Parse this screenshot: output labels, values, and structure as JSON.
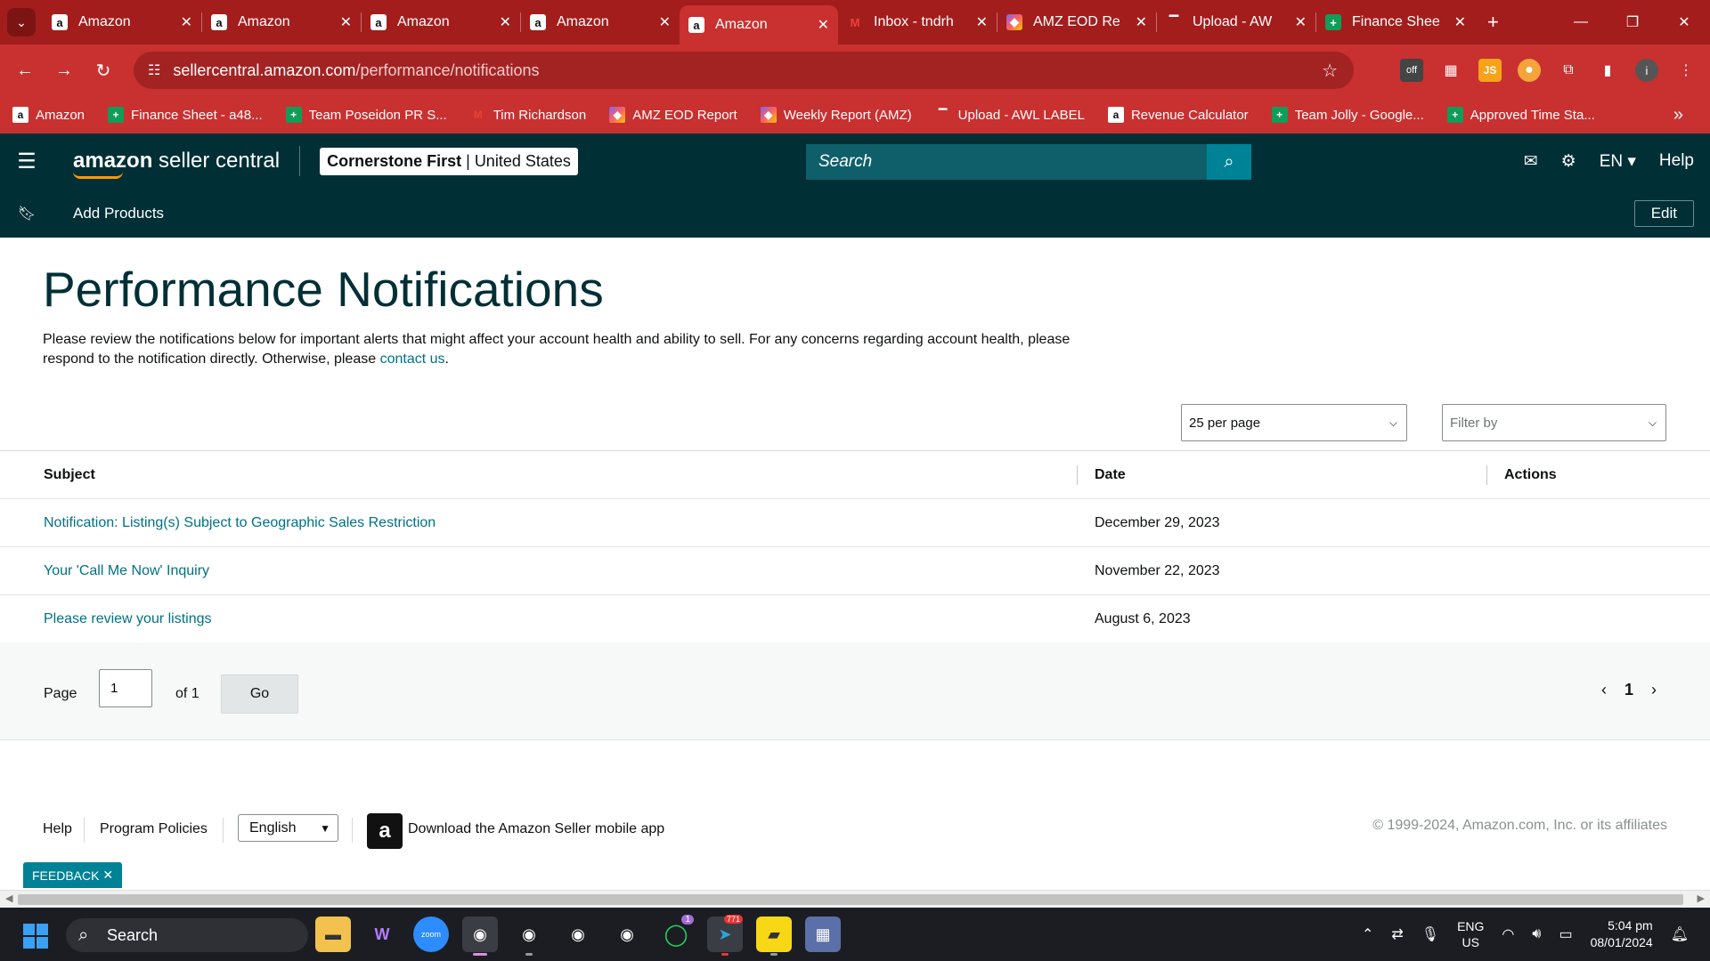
{
  "browser": {
    "tabs": [
      {
        "title": "Amazon",
        "icon": "amazon-icon",
        "active": false
      },
      {
        "title": "Amazon",
        "icon": "amazon-icon",
        "active": false
      },
      {
        "title": "Amazon",
        "icon": "amazon-icon",
        "active": false
      },
      {
        "title": "Amazon",
        "icon": "amazon-icon",
        "active": false
      },
      {
        "title": "Amazon",
        "icon": "amazon-icon",
        "active": true
      },
      {
        "title": "Inbox - tndrh",
        "icon": "gmail-icon",
        "active": false
      },
      {
        "title": "AMZ EOD Re",
        "icon": "clickup-icon",
        "active": false
      },
      {
        "title": "Upload - AW",
        "icon": "upload-icon",
        "active": false
      },
      {
        "title": "Finance Shee",
        "icon": "sheets-icon",
        "active": false
      }
    ],
    "url_host": "sellercentral.amazon.com",
    "url_path": "/performance/notifications",
    "bookmarks": [
      {
        "title": "Amazon",
        "icon": "amazon-icon"
      },
      {
        "title": "Finance Sheet - a48...",
        "icon": "sheets-icon"
      },
      {
        "title": "Team Poseidon PR S...",
        "icon": "sheets-icon"
      },
      {
        "title": "Tim Richardson",
        "icon": "gmail-icon"
      },
      {
        "title": "AMZ EOD Report",
        "icon": "clickup-icon"
      },
      {
        "title": "Weekly Report (AMZ)",
        "icon": "clickup-icon"
      },
      {
        "title": "Upload - AWL LABEL",
        "icon": "upload-icon"
      },
      {
        "title": "Revenue Calculator",
        "icon": "amazon-icon"
      },
      {
        "title": "Team Jolly - Google...",
        "icon": "sheets-icon"
      },
      {
        "title": "Approved Time Sta...",
        "icon": "sheets-icon"
      }
    ]
  },
  "header": {
    "logo_bold": "amazon",
    "logo_rest": " seller central",
    "store_name": "Cornerstone First",
    "store_region": "United States",
    "search_placeholder": "Search",
    "language": "EN",
    "help": "Help"
  },
  "subnav": {
    "add_products": "Add Products",
    "edit": "Edit"
  },
  "page": {
    "title": "Performance Notifications",
    "intro": "Please review the notifications below for important alerts that might affect your account health and ability to sell. For any concerns regarding account health, please respond to the notification directly. Otherwise, please ",
    "contact_link": "contact us",
    "intro_end": ".",
    "per_page": "25 per page",
    "filter_placeholder": "Filter by",
    "columns": {
      "subject": "Subject",
      "date": "Date",
      "actions": "Actions"
    },
    "rows": [
      {
        "subject": "Notification: Listing(s) Subject to Geographic Sales Restriction",
        "date": "December 29, 2023"
      },
      {
        "subject": "Your 'Call Me Now' Inquiry",
        "date": "November 22, 2023"
      },
      {
        "subject": "Please review your listings",
        "date": "August 6, 2023"
      }
    ],
    "pager": {
      "page_label": "Page",
      "page_value": "1",
      "of_label": "of 1",
      "go": "Go",
      "current": "1"
    }
  },
  "footer": {
    "help": "Help",
    "policies": "Program Policies",
    "language": "English",
    "app_text": "Download the Amazon Seller mobile app",
    "copyright": "© 1999-2024, Amazon.com, Inc. or its affiliates"
  },
  "feedback": "FEEDBACK",
  "taskbar": {
    "search": "Search",
    "lang_top": "ENG",
    "lang_bottom": "US",
    "time": "5:04 pm",
    "date": "08/01/2024",
    "telegram_badge": "771",
    "whatsapp_badge": "1"
  },
  "colors": {
    "chrome": "#c93030",
    "header": "#002f36",
    "link": "#007185",
    "accent": "#ff9900"
  }
}
